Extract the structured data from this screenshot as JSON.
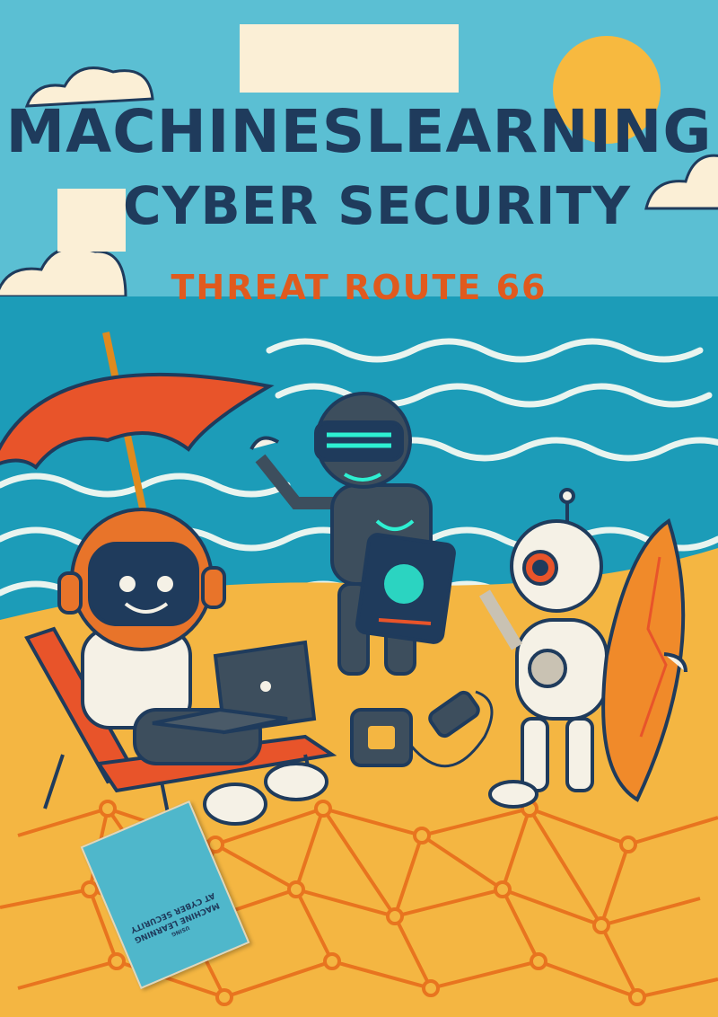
{
  "cover": {
    "title_line_1": "MACHINESLEARNING",
    "title_line_2": "CYBER SECURITY",
    "subtitle": "THREAT ROUTE 66",
    "mini_cover_line_1": "MACHINE LEARNING",
    "mini_cover_line_2": "AT CYBER SECURITY",
    "mini_cover_line_3": "USING"
  },
  "colors": {
    "sky": "#5bbfd3",
    "sand": "#f4b642",
    "title": "#1f3b5c",
    "subtitle": "#e05a1e",
    "sun": "#f7b93f",
    "label_box": "#fbefd6"
  },
  "icons": [
    "sun-icon",
    "cloud-icon",
    "umbrella-icon",
    "robot-icon",
    "laptop-icon",
    "tablet-icon",
    "surfboard-icon",
    "charger-icon",
    "network-pattern-icon"
  ]
}
